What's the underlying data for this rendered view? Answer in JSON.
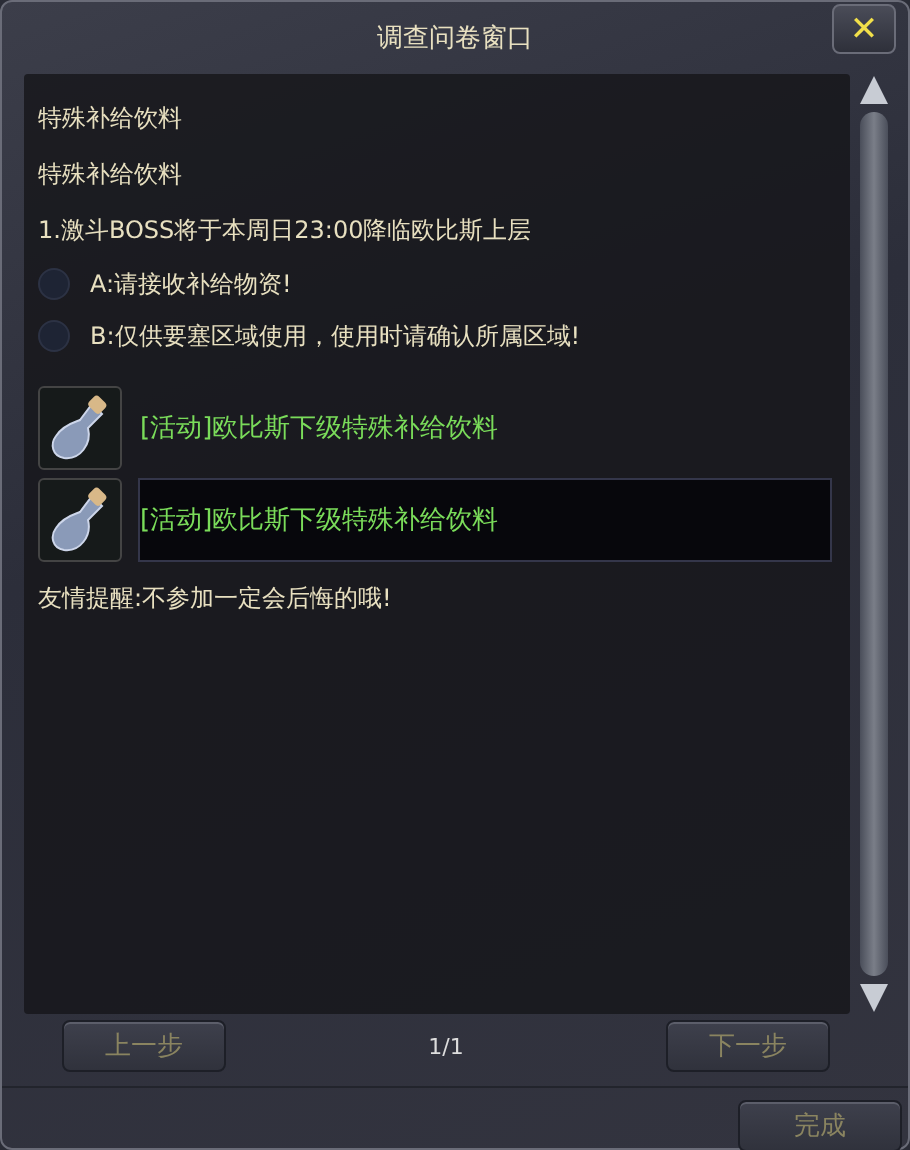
{
  "window": {
    "title": "调查问卷窗口",
    "close": "✕"
  },
  "lines": [
    "特殊补给饮料",
    "特殊补给饮料",
    "1.激斗BOSS将于本周日23:00降临欧比斯上层"
  ],
  "options": [
    {
      "label": "A:请接收补给物资!",
      "selected": false
    },
    {
      "label": "B:仅供要塞区域使用，使用时请确认所属区域!",
      "selected": false
    }
  ],
  "items": [
    {
      "name": "[活动]欧比斯下级特殊补给饮料",
      "selected": false
    },
    {
      "name": "[活动]欧比斯下级特殊补给饮料",
      "selected": true
    }
  ],
  "reminder": "友情提醒:不参加一定会后悔的哦!",
  "nav": {
    "prev": {
      "label": "上一步",
      "disabled": true
    },
    "page": "1/1",
    "next": {
      "label": "下一步",
      "disabled": true
    }
  },
  "finish": {
    "label": "完成",
    "disabled": true
  }
}
